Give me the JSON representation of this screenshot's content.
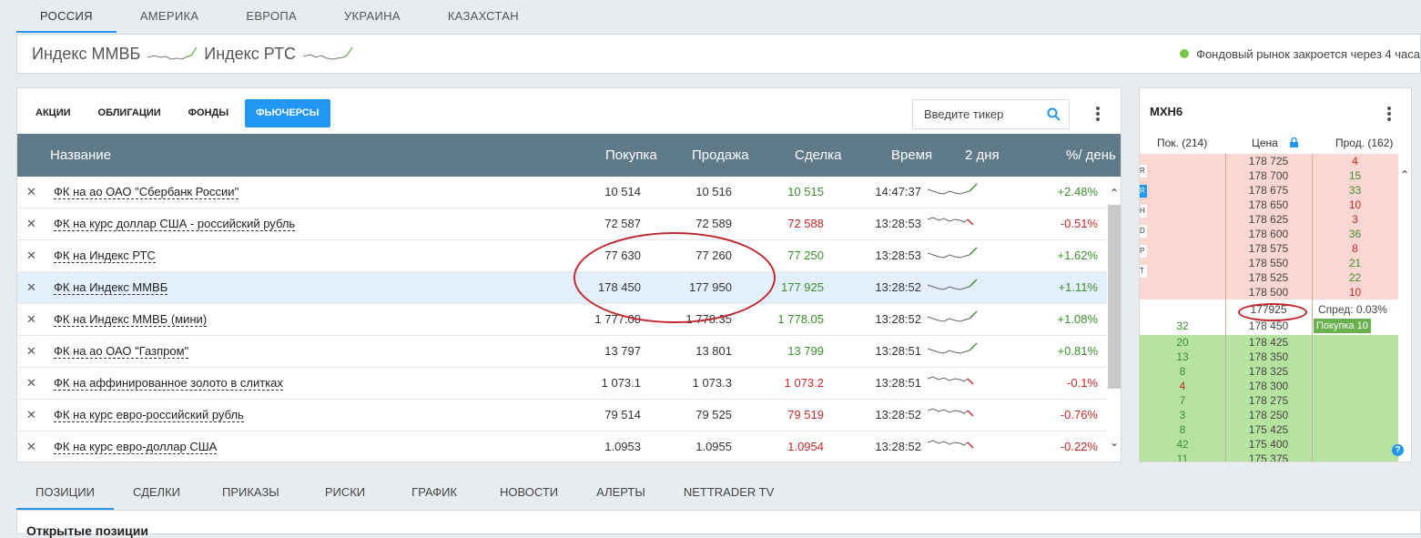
{
  "region_tabs": [
    "РОССИЯ",
    "АМЕРИКА",
    "ЕВРОПА",
    "УКРАИНА",
    "КАЗАХСТАН"
  ],
  "indices": [
    "Индекс ММВБ",
    "Индекс РТС"
  ],
  "market_status": "Фондовый рынок закроется через 4 часа",
  "asset_tabs": [
    "АКЦИИ",
    "ОБЛИГАЦИИ",
    "ФОНДЫ",
    "ФЬЮЧЕРСЫ"
  ],
  "search": {
    "placeholder": "Введите тикер"
  },
  "columns": {
    "name": "Название",
    "bid": "Покупка",
    "ask": "Продажа",
    "last": "Сделка",
    "time": "Время",
    "days": "2 дня",
    "change": "%/ день"
  },
  "rows": [
    {
      "name": "ФК на ао ОАО \"Сбербанк России\"",
      "bid": "10 514",
      "ask": "10 516",
      "last": "10 515",
      "time": "14:47:37",
      "change": "+2.48%",
      "dir": "up"
    },
    {
      "name": "ФК на курс доллар США - российский рубль",
      "bid": "72 587",
      "ask": "72 589",
      "last": "72 588",
      "time": "13:28:53",
      "change": "-0.51%",
      "dir": "down"
    },
    {
      "name": "ФК на Индекс РТС",
      "bid": "77 630",
      "ask": "77 260",
      "last": "77 250",
      "time": "13:28:53",
      "change": "+1.62%",
      "dir": "up"
    },
    {
      "name": "ФК на Индекс ММВБ",
      "bid": "178 450",
      "ask": "177 950",
      "last": "177 925",
      "time": "13:28:52",
      "change": "+1.11%",
      "dir": "up"
    },
    {
      "name": "ФК на Индекс ММВБ (мини)",
      "bid": "1 777.00",
      "ask": "1 778.35",
      "last": "1 778.05",
      "time": "13:28:52",
      "change": "+1.08%",
      "dir": "up"
    },
    {
      "name": "ФК на ао ОАО \"Газпром\"",
      "bid": "13 797",
      "ask": "13 801",
      "last": "13 799",
      "time": "13:28:51",
      "change": "+0.81%",
      "dir": "up"
    },
    {
      "name": "ФК на аффинированное золото в слитках",
      "bid": "1 073.1",
      "ask": "1 073.3",
      "last": "1 073.2",
      "time": "13:28:51",
      "change": "-0.1%",
      "dir": "down"
    },
    {
      "name": "ФК на курс евро-российский рубль",
      "bid": "79 514",
      "ask": "79 525",
      "last": "79 519",
      "time": "13:28:52",
      "change": "-0.76%",
      "dir": "down"
    },
    {
      "name": "ФК на курс евро-доллар США",
      "bid": "1.0953",
      "ask": "1.0955",
      "last": "1.0954",
      "time": "13:28:52",
      "change": "-0.22%",
      "dir": "down"
    }
  ],
  "orderbook": {
    "ticker": "MXH6",
    "head": {
      "buy": "Пок. (214)",
      "price": "Цена",
      "sell": "Прод. (162)"
    },
    "side_buttons": [
      "R",
      "R",
      "H",
      "D",
      "P",
      "T"
    ],
    "asks": [
      [
        "178 725",
        "4"
      ],
      [
        "178 700",
        "15"
      ],
      [
        "178 675",
        "33"
      ],
      [
        "178 650",
        "10"
      ],
      [
        "178 625",
        "3"
      ],
      [
        "178 600",
        "36"
      ],
      [
        "178 575",
        "8"
      ],
      [
        "178 550",
        "21"
      ],
      [
        "178 525",
        "22"
      ],
      [
        "178 500",
        "10"
      ]
    ],
    "last_price": "177925",
    "spread": "Спред: 0.03%",
    "best_bid": {
      "qty": "32",
      "price": "178 450",
      "tag": "Покупка 10"
    },
    "bids": [
      [
        "20",
        "178 425"
      ],
      [
        "13",
        "178 350"
      ],
      [
        "8",
        "178 325"
      ],
      [
        "4",
        "178 300"
      ],
      [
        "7",
        "178 275"
      ],
      [
        "3",
        "178 250"
      ],
      [
        "8",
        "175 425"
      ],
      [
        "42",
        "175 400"
      ],
      [
        "11",
        "175 375"
      ]
    ],
    "help": "?"
  },
  "bottom_tabs": [
    "ПОЗИЦИИ",
    "СДЕЛКИ",
    "ПРИКАЗЫ",
    "РИСКИ",
    "ГРАФИК",
    "НОВОСТИ",
    "АЛЕРТЫ",
    "NETTRADER TV"
  ],
  "open_positions_title": "Открытые позиции",
  "colors": {
    "accent": "#2196f3",
    "up": "#3c8d2f",
    "down": "#c62828",
    "header": "#5f7b89"
  }
}
